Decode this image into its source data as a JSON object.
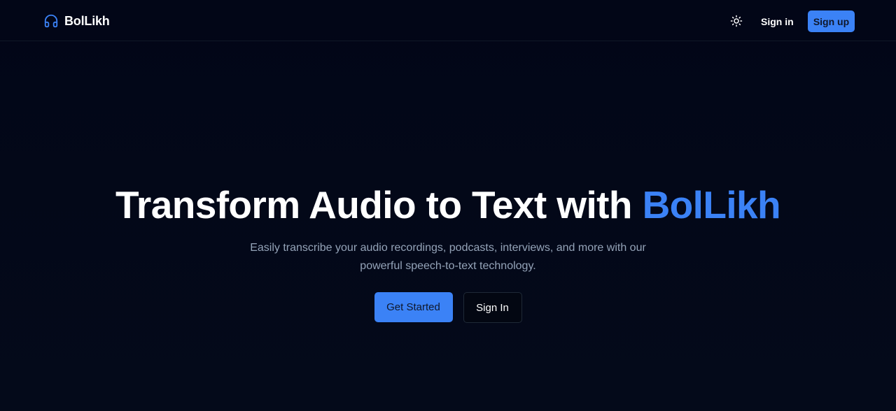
{
  "header": {
    "brand_name": "BolLikh",
    "brand_icon": "headphones-icon",
    "theme_icon": "sun-icon",
    "signin_label": "Sign in",
    "signup_label": "Sign up"
  },
  "hero": {
    "title_main": "Transform Audio to Text with ",
    "title_accent": "BolLikh",
    "subtitle": "Easily transcribe your audio recordings, podcasts, interviews, and more with our powerful speech-to-text technology.",
    "primary_label": "Get Started",
    "secondary_label": "Sign In"
  },
  "colors": {
    "background": "#030712",
    "accent": "#3b82f6",
    "text": "#ffffff",
    "muted": "#94a3b8"
  }
}
